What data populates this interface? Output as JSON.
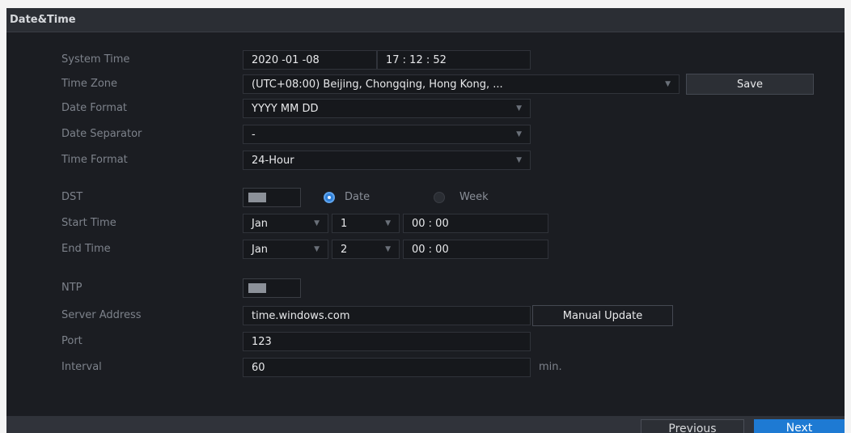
{
  "panel": {
    "title": "Date&Time"
  },
  "system_time": {
    "label": "System Time",
    "date_value": "2020 -01 -08",
    "time_value": "17 : 12 : 52"
  },
  "time_zone": {
    "label": "Time Zone",
    "value": "(UTC+08:00) Beijing, Chongqing, Hong Kong, ..."
  },
  "save_button": "Save",
  "date_format": {
    "label": "Date Format",
    "value": "YYYY MM DD"
  },
  "date_separator": {
    "label": "Date Separator",
    "value": "-"
  },
  "time_format": {
    "label": "Time Format",
    "value": "24-Hour"
  },
  "dst": {
    "label": "DST",
    "enabled": false,
    "mode_options": [
      "Date",
      "Week"
    ],
    "selected_mode": "Date"
  },
  "start_time": {
    "label": "Start Time",
    "month": "Jan",
    "day": "1",
    "time": "00 : 00"
  },
  "end_time": {
    "label": "End Time",
    "month": "Jan",
    "day": "2",
    "time": "00 : 00"
  },
  "ntp": {
    "label": "NTP",
    "enabled": false
  },
  "server_address": {
    "label": "Server Address",
    "value": "time.windows.com"
  },
  "manual_update_button": "Manual Update",
  "port": {
    "label": "Port",
    "value": "123"
  },
  "interval": {
    "label": "Interval",
    "value": "60",
    "unit": "min."
  },
  "footer": {
    "previous": "Previous",
    "next": "Next"
  },
  "colors": {
    "accent": "#2e7fd8",
    "background": "#1b1d22",
    "label_text": "#7d828b",
    "value_text": "#e8e9eb"
  }
}
